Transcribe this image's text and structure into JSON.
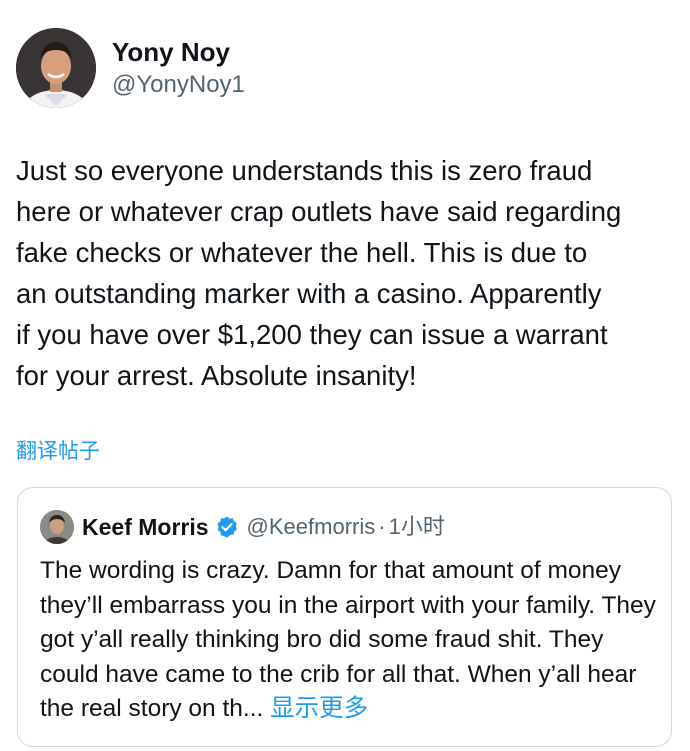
{
  "author": {
    "display_name": "Yony Noy",
    "handle": "@YonyNoy1",
    "avatar_icon": "profile-photo"
  },
  "tweet": {
    "text_lines": [
      "Just so everyone understands this is zero fraud",
      "here or whatever crap outlets have said regarding",
      "fake checks or whatever the hell. This is due to",
      "an outstanding marker with a casino. Apparently",
      "if you have over $1,200 they can issue a warrant",
      "for your arrest. Absolute insanity!"
    ],
    "translate_label": "翻译帖子"
  },
  "quoted": {
    "display_name": "Keef Morris",
    "verified_icon": "verified-badge-icon",
    "handle": "@Keefmorris",
    "separator": "·",
    "time": "1小时",
    "text": "The wording is crazy. Damn for that amount of money they’ll embarrass you in the airport with your family. They got y’all really thinking bro did some fraud shit. They could have came to the crib for all that. When y’all hear the real story on th...",
    "show_more_label": "显示更多"
  },
  "colors": {
    "text": "#0f1419",
    "secondary": "#536471",
    "accent": "#1d9bf0",
    "border": "#cfd9de"
  }
}
